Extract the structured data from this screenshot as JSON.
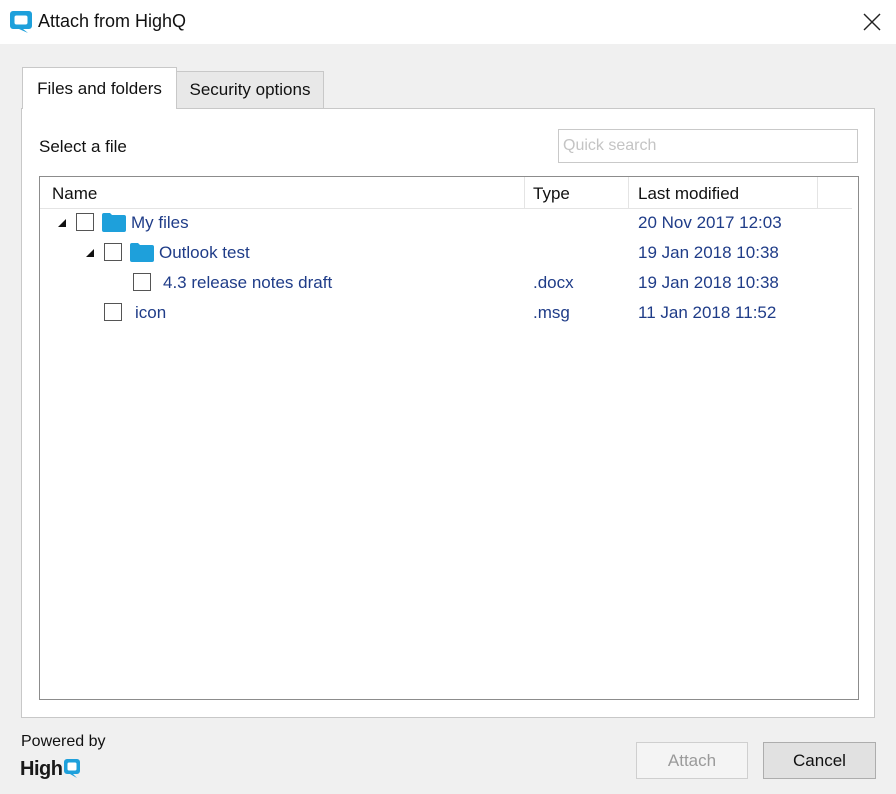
{
  "window": {
    "title": "Attach from HighQ",
    "accent_color": "#1ea0db"
  },
  "tabs": [
    {
      "label": "Files and folders",
      "active": true
    },
    {
      "label": "Security options",
      "active": false
    }
  ],
  "panel": {
    "select_label": "Select a file",
    "search_placeholder": "Quick search",
    "search_value": ""
  },
  "grid": {
    "columns": [
      "Name",
      "Type",
      "Last modified"
    ],
    "rows": [
      {
        "name": "My files",
        "type": "",
        "modified": "20 Nov 2017 12:03",
        "kind": "folder",
        "expanded": true,
        "checked": false
      },
      {
        "name": "Outlook test",
        "type": "",
        "modified": "19 Jan 2018 10:38",
        "kind": "folder",
        "expanded": true,
        "checked": false
      },
      {
        "name": "4.3 release notes draft",
        "type": ".docx",
        "modified": "19 Jan 2018 10:38",
        "kind": "file",
        "checked": false
      },
      {
        "name": "icon",
        "type": ".msg",
        "modified": "11 Jan 2018 11:52",
        "kind": "file",
        "checked": false
      }
    ],
    "text_color": "#1f3c88"
  },
  "footer": {
    "powered_by": "Powered by",
    "brand": "HighQ",
    "attach_label": "Attach",
    "attach_enabled": false,
    "cancel_label": "Cancel"
  }
}
